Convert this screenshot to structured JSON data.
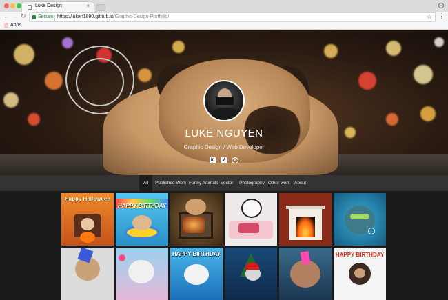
{
  "browser": {
    "tab_title": "Luke Design",
    "tab_close": "×",
    "secure_label": "Secure",
    "url_host": "https://luken1990.github.io",
    "url_path": "/Graphic-Design-Portfolio/",
    "bookmark_apps": "Apps"
  },
  "hero": {
    "name": "LUKE NGUYEN",
    "subtitle": "Graphic Design / Web Developer",
    "social": [
      {
        "label": "in",
        "icon": "linkedin-icon"
      },
      {
        "label": "V",
        "icon": "vimeo-icon"
      },
      {
        "label": "A",
        "icon": "behance-icon"
      }
    ]
  },
  "nav": {
    "items": [
      "All",
      "Published Work",
      "Funny Animals",
      "Vector",
      "Photography",
      "Other work",
      "About"
    ],
    "active": "All"
  },
  "gallery": {
    "row1": [
      {
        "caption": "Happy Halloween",
        "bg": "#e2701f"
      },
      {
        "caption": "HAPPY BIRTHDAY",
        "bg": "#47b8d8"
      },
      {
        "caption": "",
        "bg": "#6b4a2a"
      },
      {
        "caption": "",
        "bg": "#e8e4e2"
      },
      {
        "caption": "",
        "bg": "#7a2a1a"
      },
      {
        "caption": "",
        "bg": "#2d8fb0"
      }
    ],
    "row2": [
      {
        "caption": "",
        "bg": "#d8d8d8"
      },
      {
        "caption": "",
        "bg": "#8fc6e6"
      },
      {
        "caption": "HAPPY BIRTHDAY",
        "bg": "#3aa0d8"
      },
      {
        "caption": "",
        "bg": "#1c5a8a"
      },
      {
        "caption": "",
        "bg": "#2f5a7a"
      },
      {
        "caption": "HAPPY BIRTHDAY",
        "bg": "#f0f0f0"
      }
    ]
  }
}
